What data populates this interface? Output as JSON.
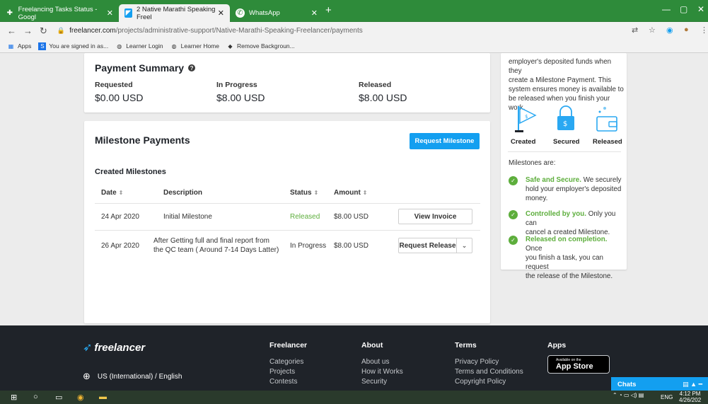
{
  "browser": {
    "tabs": [
      {
        "title": "Freelancing Tasks Status - Googl",
        "icon": "plus-icon"
      },
      {
        "title": "2 Native Marathi Speaking Freel",
        "icon": "freelancer-icon"
      },
      {
        "title": "WhatsApp",
        "icon": "whatsapp-icon"
      }
    ],
    "url_host": "freelancer.com",
    "url_path": "/projects/administrative-support/Native-Marathi-Speaking-Freelancer/payments",
    "bookmarks": [
      "Apps",
      "You are signed in as...",
      "Learner Login",
      "Learner Home",
      "Remove Backgroun..."
    ]
  },
  "payment_summary": {
    "title": "Payment Summary",
    "columns": [
      {
        "label": "Requested",
        "value": "$0.00 USD"
      },
      {
        "label": "In Progress",
        "value": "$8.00 USD"
      },
      {
        "label": "Released",
        "value": "$8.00 USD"
      }
    ]
  },
  "milestones": {
    "title": "Milestone Payments",
    "request_button": "Request Milestone",
    "created_title": "Created Milestones",
    "headers": {
      "date": "Date",
      "description": "Description",
      "status": "Status",
      "amount": "Amount"
    },
    "rows": [
      {
        "date": "24 Apr 2020",
        "description": "Initial Milestone",
        "status": "Released",
        "amount": "$8.00 USD",
        "action": "View Invoice"
      },
      {
        "date": "26 Apr 2020",
        "description_1": "After Getting full and final report from",
        "description_2": "the QC team ( Around 7-14 Days Latter)",
        "status": "In Progress",
        "amount": "$8.00 USD",
        "action": "Request Release"
      }
    ]
  },
  "info_panel": {
    "intro_1": "employer's deposited funds when they",
    "intro_2": "create a Milestone Payment. This",
    "intro_3": "system ensures money is available to",
    "intro_4": "be released when you finish your work.",
    "stages": [
      "Created",
      "Secured",
      "Released"
    ],
    "are_label": "Milestones are:",
    "features": [
      {
        "bold": "Safe and Secure.",
        "text_1": " We securely",
        "text_2": "hold your employer's deposited",
        "text_3": "money."
      },
      {
        "bold": "Controlled by you.",
        "text_1": " Only you can",
        "text_2": "cancel a created Milestone.",
        "text_3": ""
      },
      {
        "bold": "Released on completion.",
        "text_1": " Once",
        "text_2": "you finish a task, you can request",
        "text_3": "the release of the Milestone."
      }
    ]
  },
  "footer": {
    "brand": "freelancer",
    "language": "US (International) / English",
    "columns": [
      {
        "heading": "Freelancer",
        "links": [
          "Categories",
          "Projects",
          "Contests"
        ]
      },
      {
        "heading": "About",
        "links": [
          "About us",
          "How it Works",
          "Security"
        ]
      },
      {
        "heading": "Terms",
        "links": [
          "Privacy Policy",
          "Terms and Conditions",
          "Copyright Policy"
        ]
      },
      {
        "heading": "Apps",
        "links": []
      }
    ],
    "appstore_small": "Available on the",
    "appstore_big": "App Store",
    "chats": "Chats"
  },
  "taskbar": {
    "time": "4:12 PM",
    "date": "4/26/202",
    "lang": "ENG"
  },
  "colors": {
    "primary": "#139ff0",
    "success": "#5dae3c",
    "footer_bg": "#1f2329",
    "tabstrip": "#2e8b3a"
  }
}
